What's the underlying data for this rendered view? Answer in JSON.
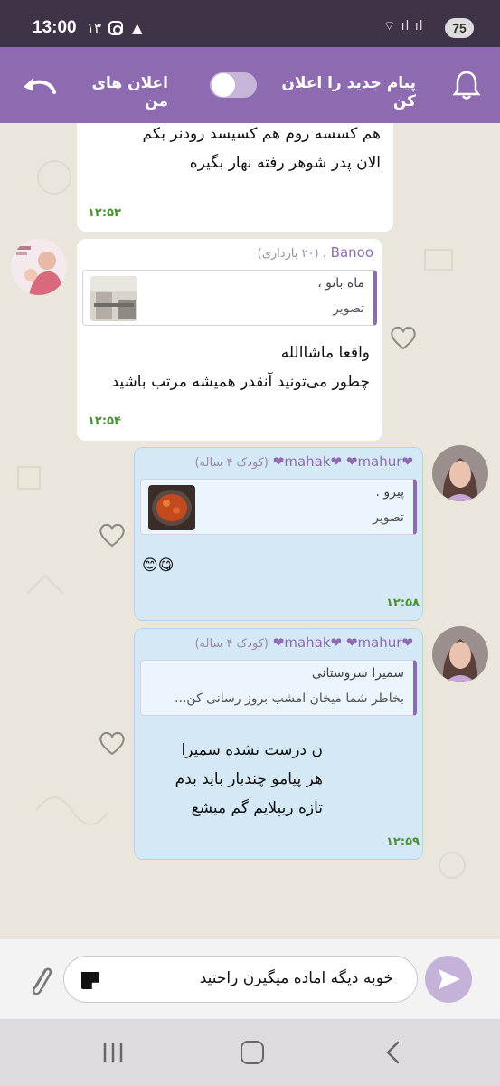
{
  "status_bar": {
    "time": "13:00",
    "notif_count": "۱۳",
    "battery": "75",
    "icons": [
      "notification-count",
      "instagram-icon",
      "triangle-app-icon",
      "wifi-icon",
      "signal-icon",
      "battery-icon"
    ]
  },
  "header": {
    "notify_label": "پیام جدید را اعلان کن",
    "my_ads_label": "اعلان های من",
    "toggle_on": false,
    "accent": "#8e6bb0"
  },
  "messages": [
    {
      "direction": "in",
      "line1": "هم کسسه روم هم کسیسد رودنر بکم",
      "line2": "الان پدر شوهر رفته نهار بگیره",
      "time": "۱۲:۵۳"
    },
    {
      "direction": "in",
      "sender": "Banoo",
      "sender_sub": ". (۲۰ بارداری)",
      "reply_name": "ماه بانو ،",
      "reply_text": "تصویر",
      "line1": "واقعا ماشاالله",
      "line2": "چطور می‌تونید آنقدر همیشه مرتب باشید",
      "time": "۱۲:۵۴"
    },
    {
      "direction": "out",
      "sender": "❤mahak❤ ❤mahur❤",
      "sender_sub": "(کودک ۴ ساله)",
      "reply_name": "پیرو .",
      "reply_text": "تصویر",
      "line1": "😋😊",
      "time": "۱۲:۵۸"
    },
    {
      "direction": "out",
      "sender": "❤mahak❤ ❤mahur❤",
      "sender_sub": "(کودک ۴ ساله)",
      "reply_name": "سمیرا سروستانی",
      "reply_text": "بخاطر شما میخان امشب بروز رسانی کن...",
      "line1": "ن درست نشده سمیرا",
      "line2": "هر پیامو چندبار باید بدم",
      "line3": "تازه ریپلایم گم میشع",
      "time": "۱۲:۵۹"
    }
  ],
  "composer": {
    "text": "خوبه دیگه اماده میگیرن راحتید"
  }
}
